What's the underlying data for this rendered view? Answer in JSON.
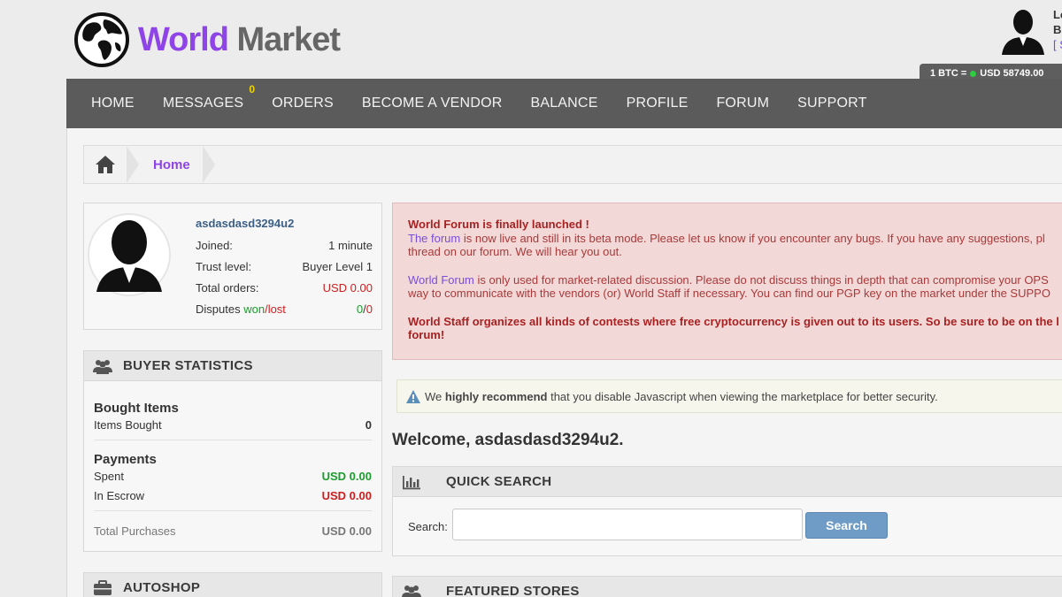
{
  "header": {
    "logo_part1": "World",
    "logo_part2": "Market",
    "user_line1": "Lo",
    "user_line2": "B",
    "user_line3": "[ S",
    "btc_label": "1 BTC =",
    "btc_value": "USD 58749.00"
  },
  "nav": {
    "items": [
      "HOME",
      "MESSAGES",
      "ORDERS",
      "BECOME A VENDOR",
      "BALANCE",
      "PROFILE",
      "FORUM",
      "SUPPORT"
    ],
    "messages_badge": "0"
  },
  "breadcrumb": {
    "current": "Home"
  },
  "profile": {
    "username": "asdasdasd3294u2",
    "joined_label": "Joined:",
    "joined_value": "1 minute",
    "trust_label": "Trust level:",
    "trust_value": "Buyer Level 1",
    "orders_label": "Total orders:",
    "orders_value": "USD 0.00",
    "disputes_label": "Disputes",
    "disputes_won": "won",
    "disputes_sep": "/",
    "disputes_lost": "lost",
    "disputes_won_value": "0",
    "disputes_lost_value": "0"
  },
  "buyer_stats": {
    "title": "BUYER STATISTICS",
    "bought_heading": "Bought Items",
    "items_bought_label": "Items Bought",
    "items_bought_value": "0",
    "payments_heading": "Payments",
    "spent_label": "Spent",
    "spent_value": "USD 0.00",
    "escrow_label": "In Escrow",
    "escrow_value": "USD 0.00",
    "total_label": "Total Purchases",
    "total_value": "USD 0.00"
  },
  "autoshop": {
    "title": "AUTOSHOP"
  },
  "alert": {
    "heading": "World Forum is finally launched !",
    "p1_link": "The forum",
    "p1_text": " is now live and still in its beta mode. Please let us know if you encounter any bugs. If you have any suggestions, pl",
    "p1_text2": "thread on our forum. We will hear you out.",
    "p2_link": "World Forum",
    "p2_text": " is only used for market-related discussion. Please do not discuss things in depth that can compromise your OPS",
    "p2_text2": "way to communicate with the vendors (or) World Staff if necessary. You can find our PGP key on the market under the SUPPO",
    "p3_text": "World Staff organizes all kinds of contests where free cryptocurrency is given out to its users. So be sure to be on the l",
    "p3_text2": "forum!"
  },
  "notice": {
    "pre": "We ",
    "bold": "highly recommend",
    "post": " that you disable Javascript when viewing the marketplace for better security."
  },
  "welcome": "Welcome, asdasdasd3294u2.",
  "quick_search": {
    "title": "QUICK SEARCH",
    "label": "Search:",
    "input_value": "",
    "button": "Search"
  },
  "featured": {
    "title": "FEATURED STORES"
  },
  "colors": {
    "brand_purple": "#8e44e6",
    "nav_bg": "#5b5b5b",
    "alert_bg": "#f3d8d8",
    "button_blue": "#6f9cc6"
  }
}
